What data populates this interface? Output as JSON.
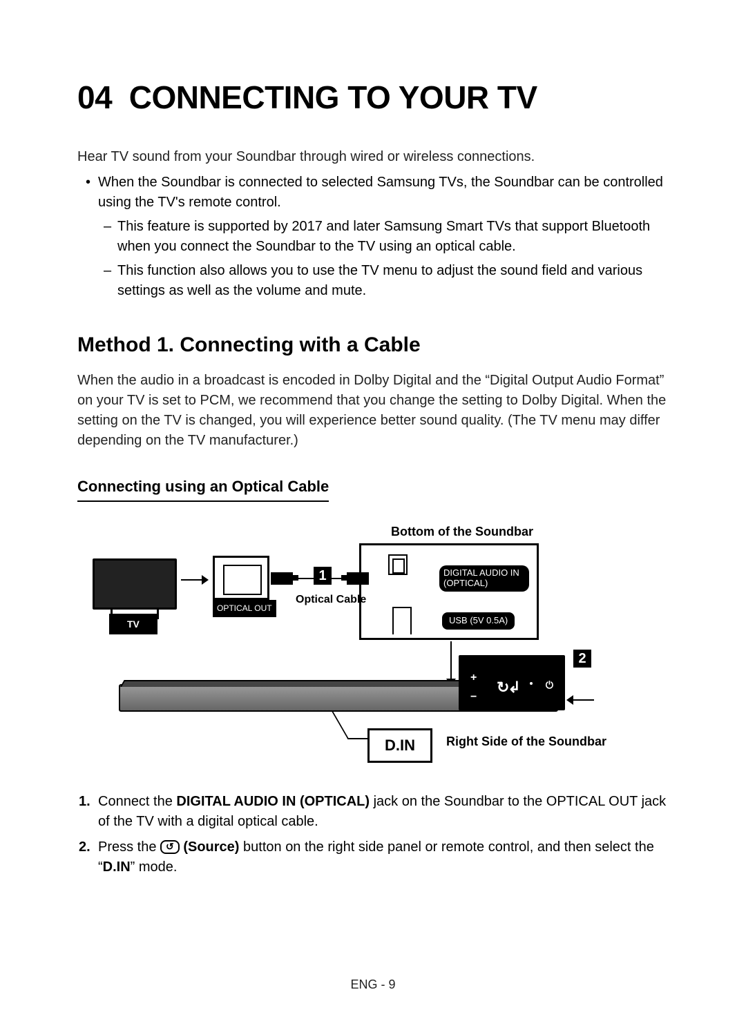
{
  "chapter": {
    "number": "04",
    "title": "CONNECTING TO YOUR TV"
  },
  "intro": "Hear TV sound from your Soundbar through wired or wireless connections.",
  "bullet1": "When the Soundbar is connected to selected Samsung TVs, the Soundbar can be controlled using the TV's remote control.",
  "sub1": "This feature is supported by 2017 and later Samsung Smart TVs that support Bluetooth when you connect the Soundbar to the TV using an optical cable.",
  "sub2": "This function also allows you to use the TV menu to adjust the sound field and various settings as well as the volume and mute.",
  "method": {
    "heading": "Method 1. Connecting with a Cable",
    "body": "When the audio in a broadcast is encoded in Dolby Digital and the “Digital Output Audio Format” on your TV is set to PCM, we recommend that you change the setting to Dolby Digital. When the setting on the TV is changed, you will experience better sound quality. (The TV menu may differ depending on the TV manufacturer.)",
    "subheading": "Connecting using an Optical Cable"
  },
  "diagram": {
    "top_label": "Bottom of the Soundbar",
    "tv_label": "TV",
    "optical_out": "OPTICAL OUT",
    "cable_label": "Optical Cable",
    "port_optical_line1": "DIGITAL AUDIO IN",
    "port_optical_line2": "(OPTICAL)",
    "port_usb": "USB (5V 0.5A)",
    "din": "D.IN",
    "side_caption": "Right Side of the Soundbar",
    "badge1": "1",
    "badge2": "2",
    "ctrl_plus": "+",
    "ctrl_minus": "−",
    "ctrl_source": "↻↲",
    "ctrl_power": "⏻"
  },
  "steps": {
    "s1_pre": "Connect the ",
    "s1_bold": "DIGITAL AUDIO IN (OPTICAL)",
    "s1_post": " jack on the Soundbar to the OPTICAL OUT jack of the TV with a digital optical cable.",
    "s2_pre": "Press the ",
    "s2_source": " (Source)",
    "s2_mid": " button on the right side panel or remote control, and then select the “",
    "s2_bold2": "D.IN",
    "s2_post": "” mode."
  },
  "page_number": "ENG - 9"
}
